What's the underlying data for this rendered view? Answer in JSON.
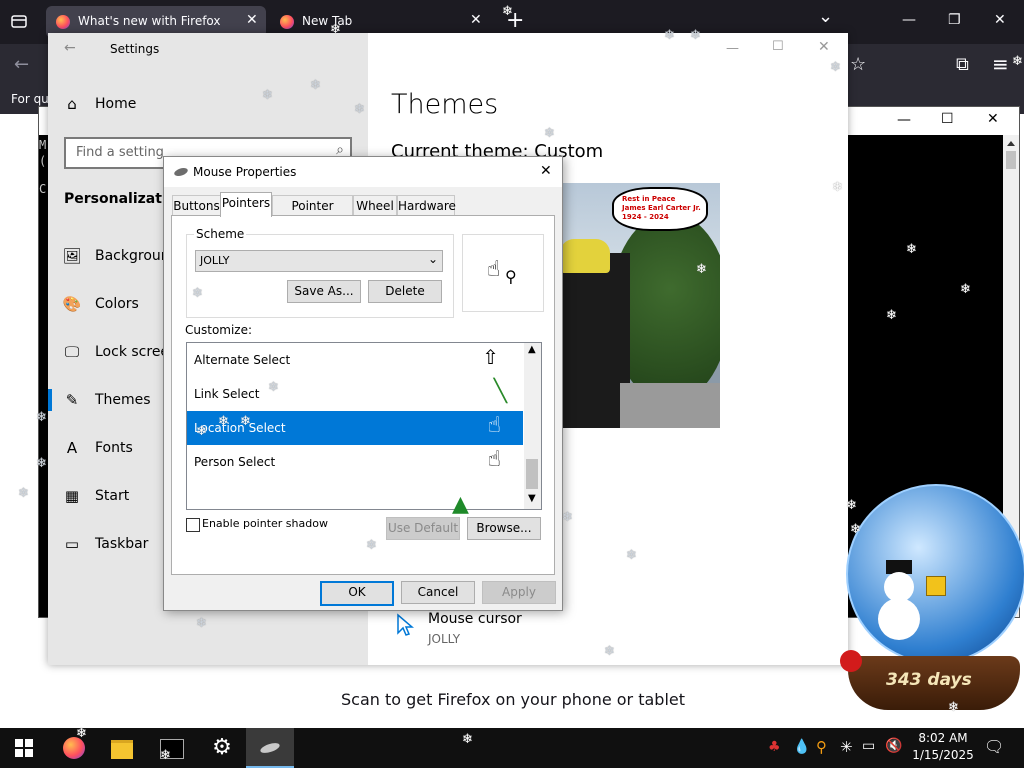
{
  "firefox": {
    "tabs": [
      {
        "label": "What's new with Firefox",
        "close": "✕"
      },
      {
        "label": "New Tab",
        "close": "✕"
      }
    ],
    "new_tab": "+",
    "list_all_tabs": "⌄",
    "window_controls": {
      "minimize": "—",
      "maximize": "❐",
      "close": "✕"
    },
    "back": "←",
    "star": "☆",
    "extensions": "⧉",
    "menu": "≡",
    "bookmarks_text": "For qu",
    "scan_text": "Scan to get Firefox on your phone or tablet"
  },
  "terminal": {
    "lines": [
      "M",
      "(",
      "C"
    ],
    "controls": {
      "minimize": "—",
      "maximize": "☐",
      "close": "✕"
    }
  },
  "settings": {
    "title": "Settings",
    "back": "←",
    "controls": {
      "minimize": "—",
      "maximize": "☐",
      "close": "✕"
    },
    "home": "Home",
    "search_placeholder": "Find a setting",
    "section": "Personalization",
    "nav": [
      {
        "label": "Background",
        "icon": "🖼"
      },
      {
        "label": "Colors",
        "icon": "🎨"
      },
      {
        "label": "Lock screen",
        "icon": "🖵"
      },
      {
        "label": "Themes",
        "icon": "✎"
      },
      {
        "label": "Fonts",
        "icon": "A"
      },
      {
        "label": "Start",
        "icon": "▦"
      },
      {
        "label": "Taskbar",
        "icon": "▭"
      }
    ],
    "page_title": "Themes",
    "current_theme": "Current theme: Custom",
    "preview_caption": [
      "Rest in Peace",
      "James Earl Carter Jr.",
      "1924 - 2024"
    ],
    "mouse_cursor_label": "Mouse cursor",
    "mouse_cursor_value": "JOLLY"
  },
  "dialog": {
    "title": "Mouse Properties",
    "close": "✕",
    "tabs": [
      "Buttons",
      "Pointers",
      "Pointer Options",
      "Wheel",
      "Hardware"
    ],
    "active_tab": "Pointers",
    "scheme_label": "Scheme",
    "scheme_value": "JOLLY",
    "save_as": "Save As...",
    "delete": "Delete",
    "customize_label": "Customize:",
    "cursor_list": [
      {
        "label": "Alternate Select",
        "glyph": "⇧"
      },
      {
        "label": "Link Select",
        "glyph": "╲"
      },
      {
        "label": "Location Select",
        "glyph": "☝"
      },
      {
        "label": "Person Select",
        "glyph": "☝"
      }
    ],
    "selected_cursor": "Location Select",
    "enable_shadow": "Enable pointer shadow",
    "shadow_checked": false,
    "use_default": "Use Default",
    "browse": "Browse...",
    "ok": "OK",
    "cancel": "Cancel",
    "apply": "Apply"
  },
  "snowglobe": {
    "days_text": "343 days"
  },
  "taskbar": {
    "time": "8:02 AM",
    "date": "1/15/2025"
  },
  "colors": {
    "accent": "#0078d7",
    "selection": "#0078d7",
    "firefox_dark": "#1c1b22",
    "taskbar": "#101010"
  }
}
